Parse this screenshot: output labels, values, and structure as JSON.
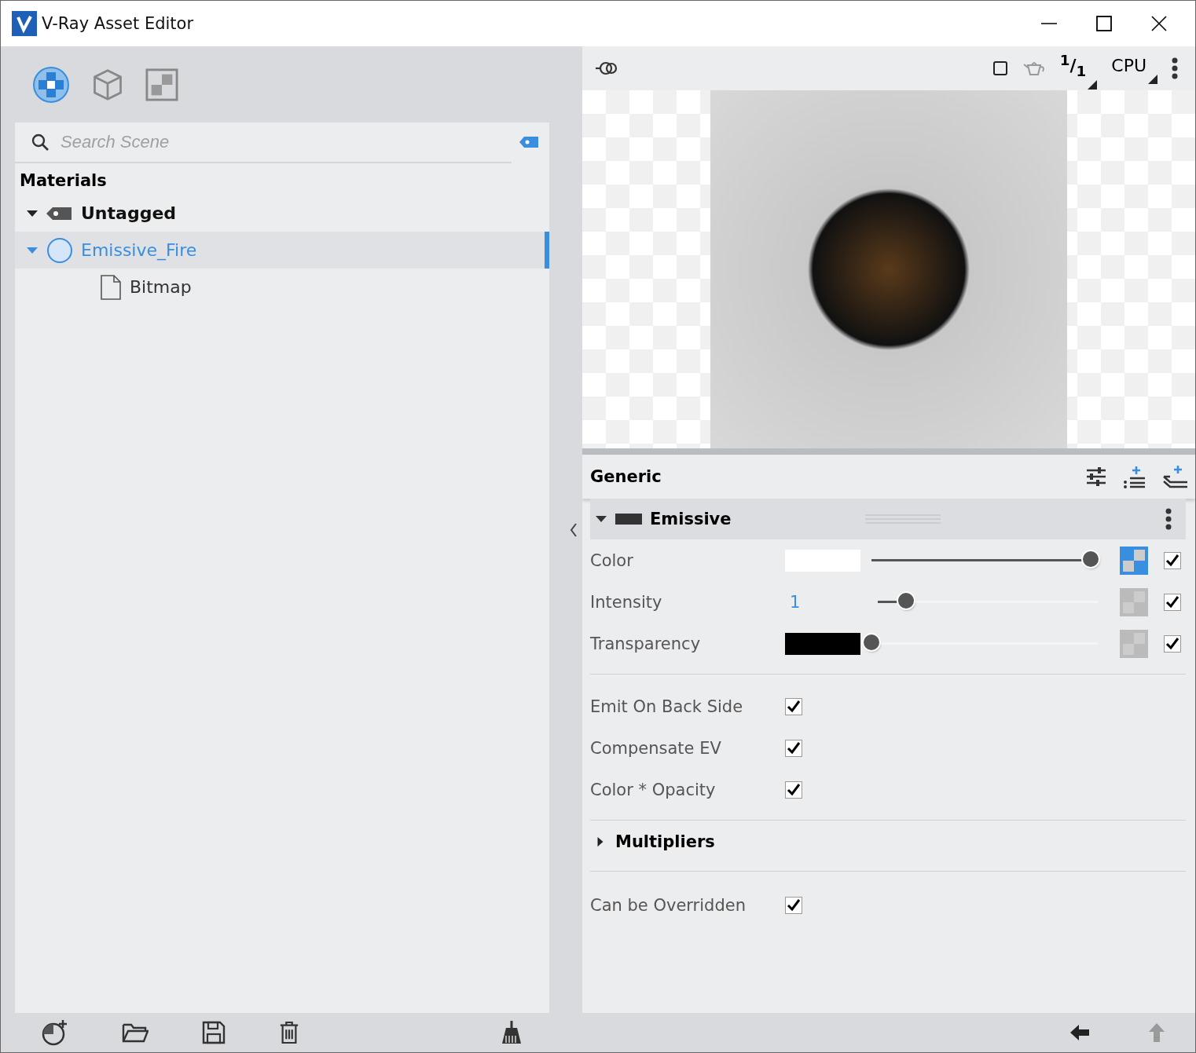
{
  "window": {
    "title": "V-Ray Asset Editor"
  },
  "categories": [
    {
      "kind": "materials",
      "selected": true
    },
    {
      "kind": "geometry",
      "selected": false
    },
    {
      "kind": "textures",
      "selected": false
    }
  ],
  "search": {
    "placeholder": "Search Scene"
  },
  "tree": {
    "heading": "Materials",
    "items": [
      {
        "label": "Untagged",
        "kind": "tag",
        "expanded": true,
        "selected": false,
        "children": [
          {
            "label": "Emissive_Fire",
            "kind": "material",
            "expanded": true,
            "selected": true,
            "children": [
              {
                "label": "Bitmap",
                "kind": "texture",
                "selected": false
              }
            ]
          }
        ]
      }
    ]
  },
  "preview_toolbar": {
    "ratio": "$^{1}$/$_{1}$",
    "engine": "CPU"
  },
  "editor": {
    "title": "Generic",
    "section": {
      "title": "Emissive",
      "expanded": true
    },
    "params": [
      {
        "kind": "color",
        "label": "Color",
        "color": "#ffffff",
        "level": 0.97,
        "mapped": true,
        "checked": true
      },
      {
        "kind": "number",
        "label": "Intensity",
        "value": "1",
        "level": 0.13,
        "mapped": false,
        "checked": true
      },
      {
        "kind": "color",
        "label": "Transparency",
        "color": "#000000",
        "level": 0,
        "mapped": false,
        "checked": true
      }
    ],
    "options": [
      {
        "label": "Emit On Back Side",
        "checked": true
      },
      {
        "label": "Compensate EV",
        "checked": true
      },
      {
        "label": "Color * Opacity",
        "checked": true
      }
    ],
    "subsection": {
      "title": "Multipliers",
      "expanded": false
    },
    "overrides": [
      {
        "label": "Can be Overridden",
        "checked": true
      }
    ]
  }
}
